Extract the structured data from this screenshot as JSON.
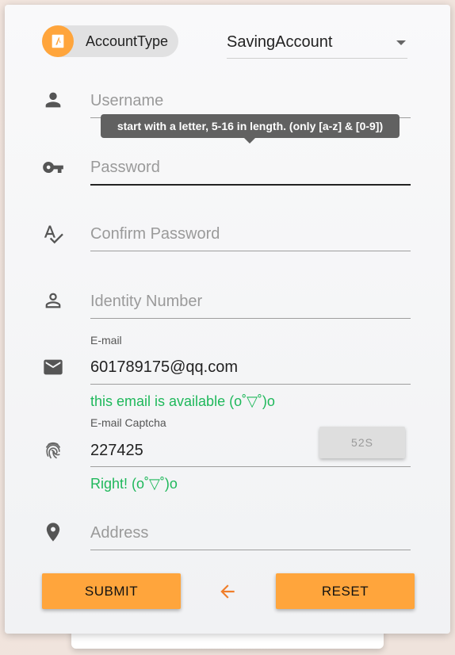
{
  "account_type": {
    "chip_label": "AccountType",
    "chip_icon": "account-type-icon",
    "selected": "SavingAccount"
  },
  "username": {
    "placeholder": "Username",
    "icon": "person-icon"
  },
  "tooltip": {
    "text": "start with a letter, 5-16 in length. (only [a-z] & [0-9])"
  },
  "password": {
    "placeholder": "Password",
    "icon": "key-icon"
  },
  "confirm_password": {
    "placeholder": "Confirm Password",
    "icon": "spellcheck-icon"
  },
  "identity": {
    "placeholder": "Identity Number",
    "icon": "person-outline-icon"
  },
  "email": {
    "label": "E-mail",
    "value": "601789175@qq.com",
    "hint": "this email is available (o˚▽˚)o",
    "icon": "mail-icon"
  },
  "captcha": {
    "label": "E-mail Captcha",
    "value": "227425",
    "countdown": "52S",
    "hint": "Right! (o˚▽˚)o",
    "icon": "fingerprint-icon"
  },
  "address": {
    "placeholder": "Address",
    "icon": "location-pin-icon"
  },
  "actions": {
    "submit_label": "SUBMIT",
    "reset_label": "RESET",
    "back_icon": "arrow-back-icon"
  },
  "colors": {
    "accent": "#ffa53c",
    "success": "#1fb85b",
    "back_arrow": "#f07e2a",
    "tooltip_bg": "#616161"
  }
}
